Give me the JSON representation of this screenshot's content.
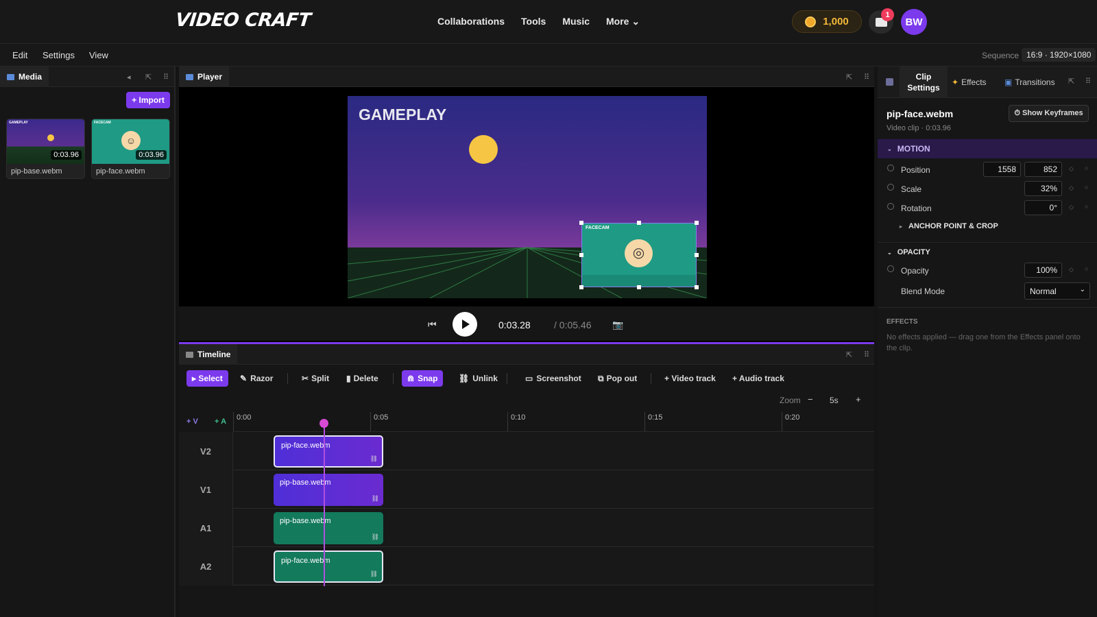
{
  "app": {
    "logo": "VIDEO CRAFT"
  },
  "nav": {
    "items": [
      "Collaborations",
      "Tools",
      "Music",
      "More ⌄"
    ]
  },
  "header": {
    "coins": "1,000",
    "notifications": "1",
    "avatar": "BW"
  },
  "menubar": {
    "items": [
      "Edit",
      "Settings",
      "View"
    ],
    "sequence_label": "Sequence",
    "sequence_value": "16:9 · 1920×1080"
  },
  "media": {
    "tab": "Media",
    "import_label": "+ Import",
    "items": [
      {
        "name": "pip-base.webm",
        "duration": "0:03.96",
        "thumb_label": "GAMEPLAY"
      },
      {
        "name": "pip-face.webm",
        "duration": "0:03.96",
        "thumb_label": "FACECAM"
      }
    ]
  },
  "player": {
    "tab": "Player",
    "overlay_title": "GAMEPLAY",
    "pip_label": "FACECAM",
    "current_time": "0:03.28",
    "total_time": "/ 0:05.46"
  },
  "timeline": {
    "tab": "Timeline",
    "tools": [
      "▸ Select",
      "Razor",
      "Split",
      "Delete",
      "Snap",
      "Unlink",
      "Screenshot",
      "Pop out",
      "+ Video track",
      "+ Audio track"
    ],
    "zoom_label": "Zoom",
    "zoom_minus": "−",
    "zoom_value": "5s",
    "zoom_plus": "+",
    "add_v": "+ V",
    "add_a": "+ A",
    "ruler": [
      "0:00",
      "0:05",
      "0:10",
      "0:15",
      "0:20"
    ],
    "tracks": [
      {
        "label": "V2",
        "clip": "pip-face.webm"
      },
      {
        "label": "V1",
        "clip": "pip-base.webm"
      },
      {
        "label": "A1",
        "clip": "pip-base.webm"
      },
      {
        "label": "A2",
        "clip": "pip-face.webm"
      }
    ]
  },
  "inspector": {
    "tabs": [
      "Clip Settings",
      "Effects",
      "Transitions"
    ],
    "clip_name": "pip-face.webm",
    "clip_meta": "Video clip · 0:03.96",
    "show_keyframes": "⏱ Show Keyframes",
    "motion_header": "MOTION",
    "position_label": "Position",
    "position_x": "1558",
    "position_y": "852",
    "scale_label": "Scale",
    "scale_value": "32%",
    "rotation_label": "Rotation",
    "rotation_value": "0°",
    "anchor_header": "ANCHOR POINT & CROP",
    "opacity_header": "OPACITY",
    "opacity_label": "Opacity",
    "opacity_value": "100%",
    "blend_label": "Blend Mode",
    "blend_value": "Normal",
    "effects_header": "EFFECTS",
    "effects_empty": "No effects applied — drag one from the Effects panel onto the clip."
  },
  "colors": {
    "accent": "#7c3aed",
    "video_clip": "#5a2fd6",
    "audio_clip": "#137a5c",
    "coin": "#f4b93a"
  }
}
